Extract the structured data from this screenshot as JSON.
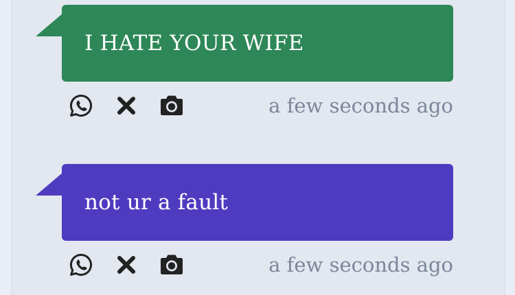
{
  "colors": {
    "page_bg": "#e9edf5",
    "panel_bg": "#e2e7f0",
    "timestamp": "#7d8799",
    "icon": "#222222"
  },
  "posts": [
    {
      "text": "I HATE YOUR WIFE",
      "color": "#2e8757",
      "timestamp": "a few seconds ago",
      "actions": [
        "whatsapp-icon",
        "close-icon",
        "camera-icon"
      ]
    },
    {
      "text": "not ur a fault",
      "color": "#4f3bbf",
      "timestamp": "a few seconds ago",
      "actions": [
        "whatsapp-icon",
        "close-icon",
        "camera-icon"
      ]
    }
  ]
}
